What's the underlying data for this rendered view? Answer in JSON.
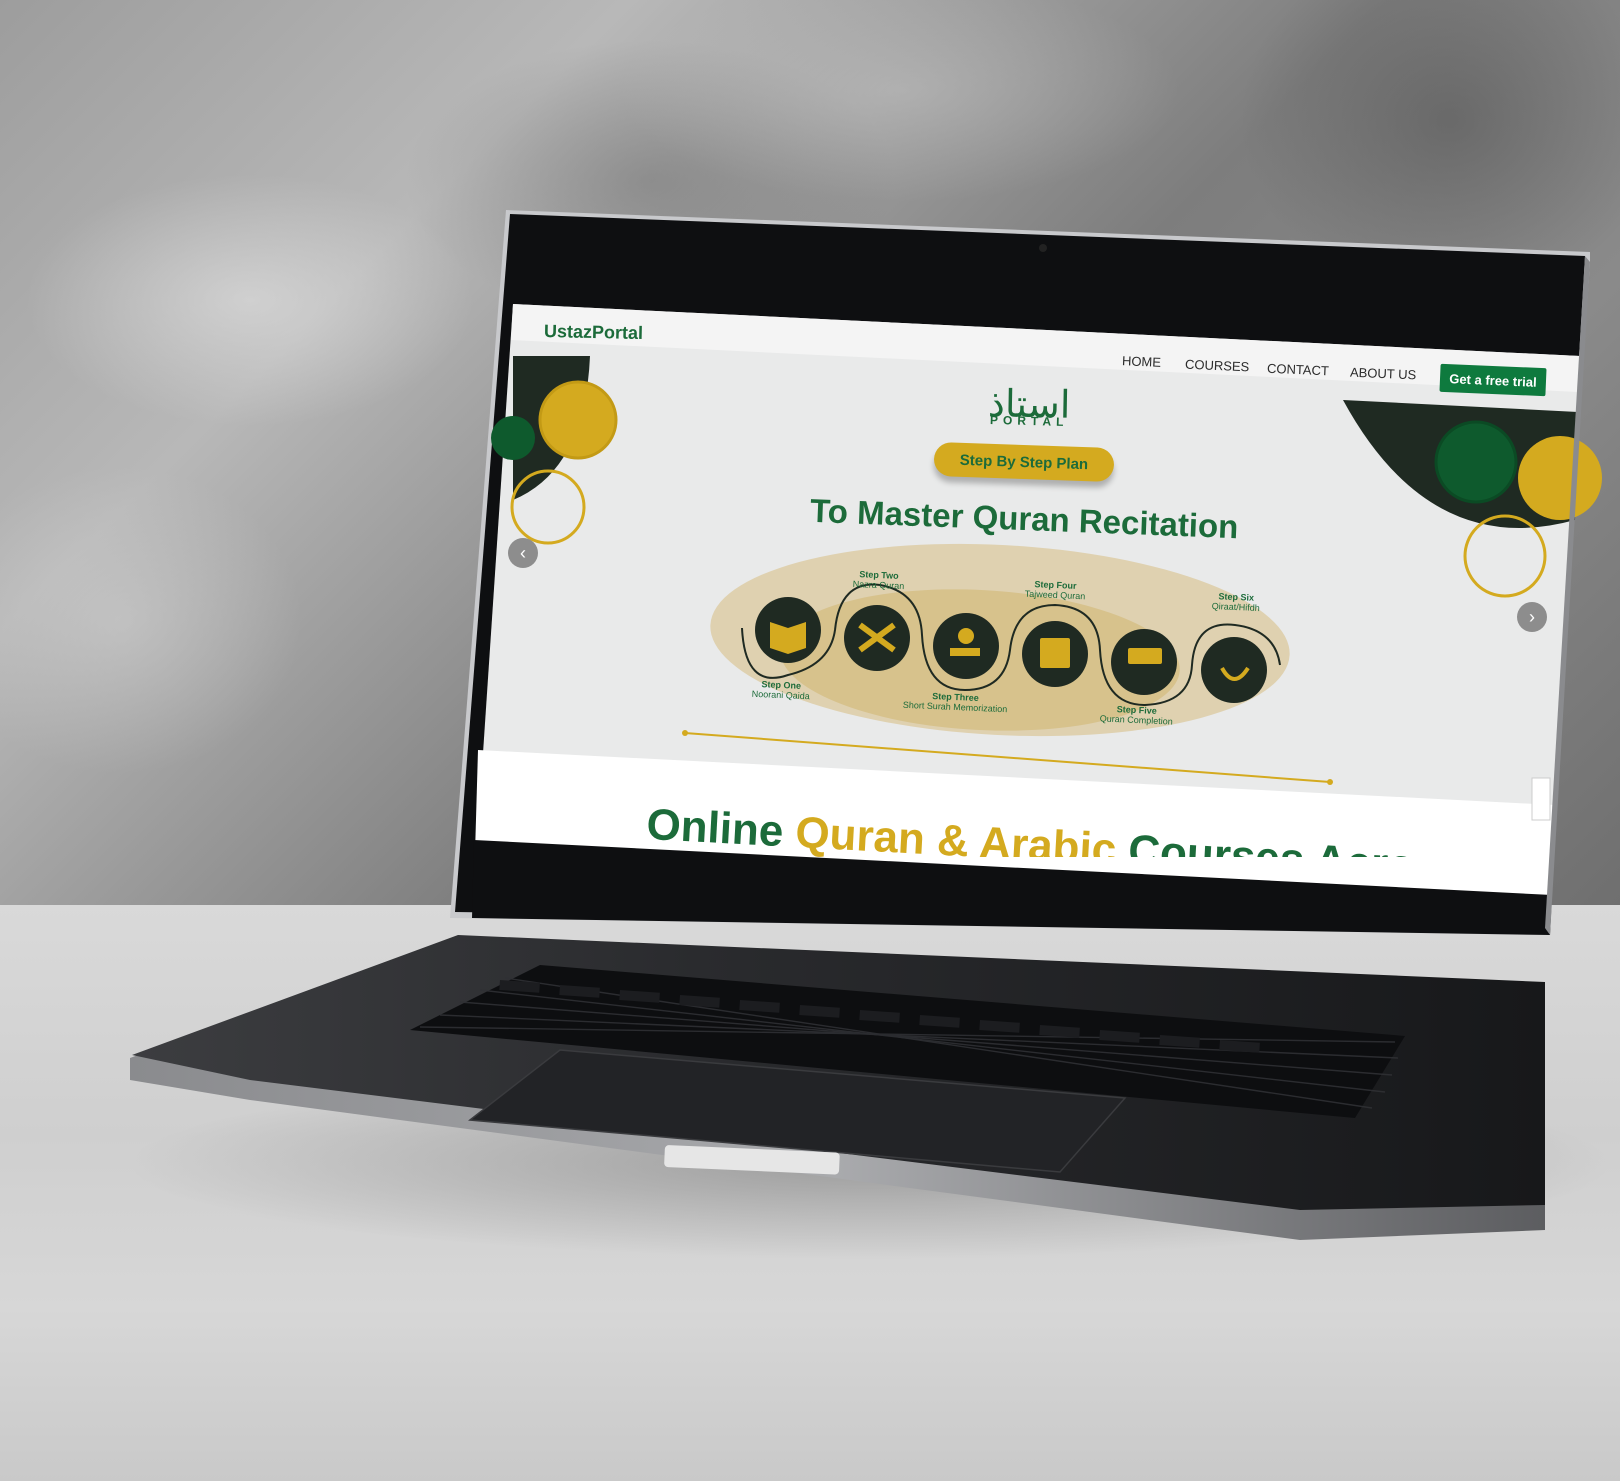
{
  "site": {
    "logo": "UstazPortal",
    "nav": {
      "home": "HOME",
      "courses": "COURSES",
      "contact": "CONTACT",
      "about": "ABOUT US",
      "cta": "Get a free trial"
    },
    "brand_arabic": "استاذ",
    "brand_english": "PORTAL"
  },
  "hero": {
    "pill": "Step By Step Plan",
    "headline": "To Master Quran Recitation",
    "steps": [
      {
        "title": "Step One",
        "subtitle": "Noorani Qaida"
      },
      {
        "title": "Step Two",
        "subtitle": "Nazra Quran"
      },
      {
        "title": "Step Three",
        "subtitle": "Short Surah Memorization"
      },
      {
        "title": "Step Four",
        "subtitle": "Tajweed Quran"
      },
      {
        "title": "Step Five",
        "subtitle": "Quran Completion"
      },
      {
        "title": "Step Six",
        "subtitle": "Qiraat/Hifdh"
      }
    ],
    "prev_arrow": "‹",
    "next_arrow": "›"
  },
  "section2": {
    "part1": "Online ",
    "part2": "Quran & Arabic",
    "part3": " Courses Across"
  },
  "colors": {
    "brand_green": "#1c6b3a",
    "cta_green": "#0e7a3e",
    "gold": "#d4aa1f",
    "dark_circle": "#1f2a22"
  }
}
